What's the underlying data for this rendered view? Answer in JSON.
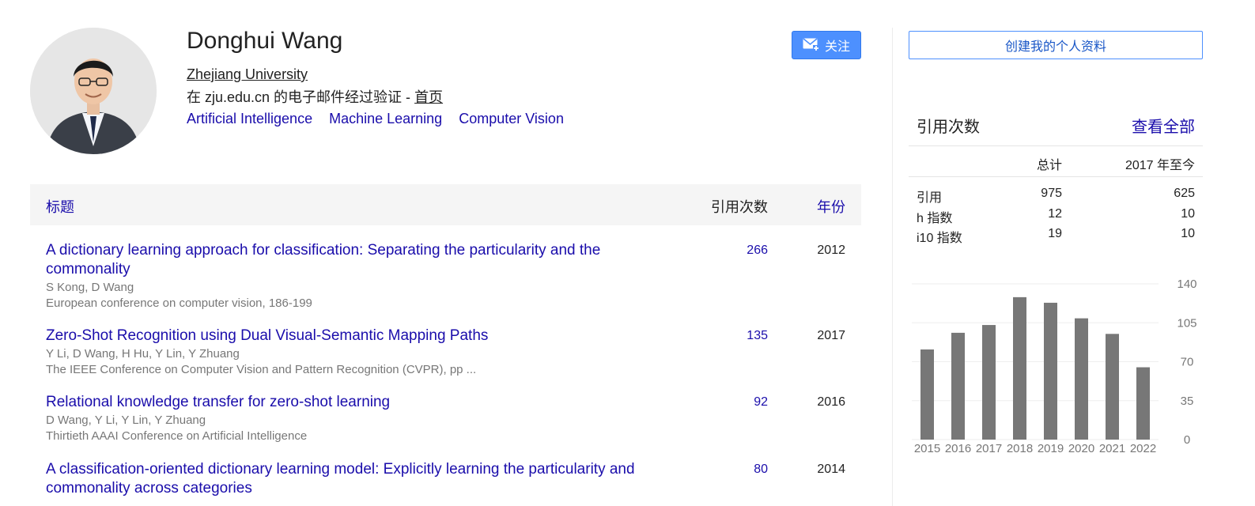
{
  "profile": {
    "name": "Donghui Wang",
    "affiliation": "Zhejiang University",
    "verified_prefix": "在 zju.edu.cn 的电子邮件经过验证 - ",
    "homepage_label": "首页",
    "interests": [
      "Artificial Intelligence",
      "Machine Learning",
      "Computer Vision"
    ],
    "follow_label": "关注"
  },
  "table": {
    "header_title": "标题",
    "header_cited": "引用次数",
    "header_year": "年份",
    "rows": [
      {
        "title": "A dictionary learning approach for classification: Separating the particularity and the commonality",
        "authors": "S Kong, D Wang",
        "venue": "European conference on computer vision, 186-199",
        "cited": "266",
        "year": "2012"
      },
      {
        "title": "Zero-Shot Recognition using Dual Visual-Semantic Mapping Paths",
        "authors": "Y Li, D Wang, H Hu, Y Lin, Y Zhuang",
        "venue": "The IEEE Conference on Computer Vision and Pattern Recognition (CVPR), pp ...",
        "cited": "135",
        "year": "2017"
      },
      {
        "title": "Relational knowledge transfer for zero-shot learning",
        "authors": "D Wang, Y Li, Y Lin, Y Zhuang",
        "venue": "Thirtieth AAAI Conference on Artificial Intelligence",
        "cited": "92",
        "year": "2016"
      },
      {
        "title": "A classification-oriented dictionary learning model: Explicitly learning the particularity and commonality across categories",
        "authors": "",
        "venue": "",
        "cited": "80",
        "year": "2014"
      }
    ]
  },
  "sidebar": {
    "create_profile_label": "创建我的个人资料",
    "citations_title": "引用次数",
    "view_all_label": "查看全部",
    "col_total": "总计",
    "col_since": "2017 年至今",
    "stats": [
      {
        "label": "引用",
        "total": "975",
        "since": "625"
      },
      {
        "label": "h 指数",
        "total": "12",
        "since": "10"
      },
      {
        "label": "i10 指数",
        "total": "19",
        "since": "10"
      }
    ]
  },
  "chart_data": {
    "type": "bar",
    "categories": [
      "2015",
      "2016",
      "2017",
      "2018",
      "2019",
      "2020",
      "2021",
      "2022"
    ],
    "values": [
      81,
      96,
      103,
      128,
      123,
      109,
      95,
      65
    ],
    "ylim": [
      0,
      140
    ],
    "yticks": [
      0,
      35,
      70,
      105,
      140
    ],
    "xlabel": "",
    "ylabel": "",
    "title": "",
    "grid": true,
    "bar_color": "#777777"
  }
}
